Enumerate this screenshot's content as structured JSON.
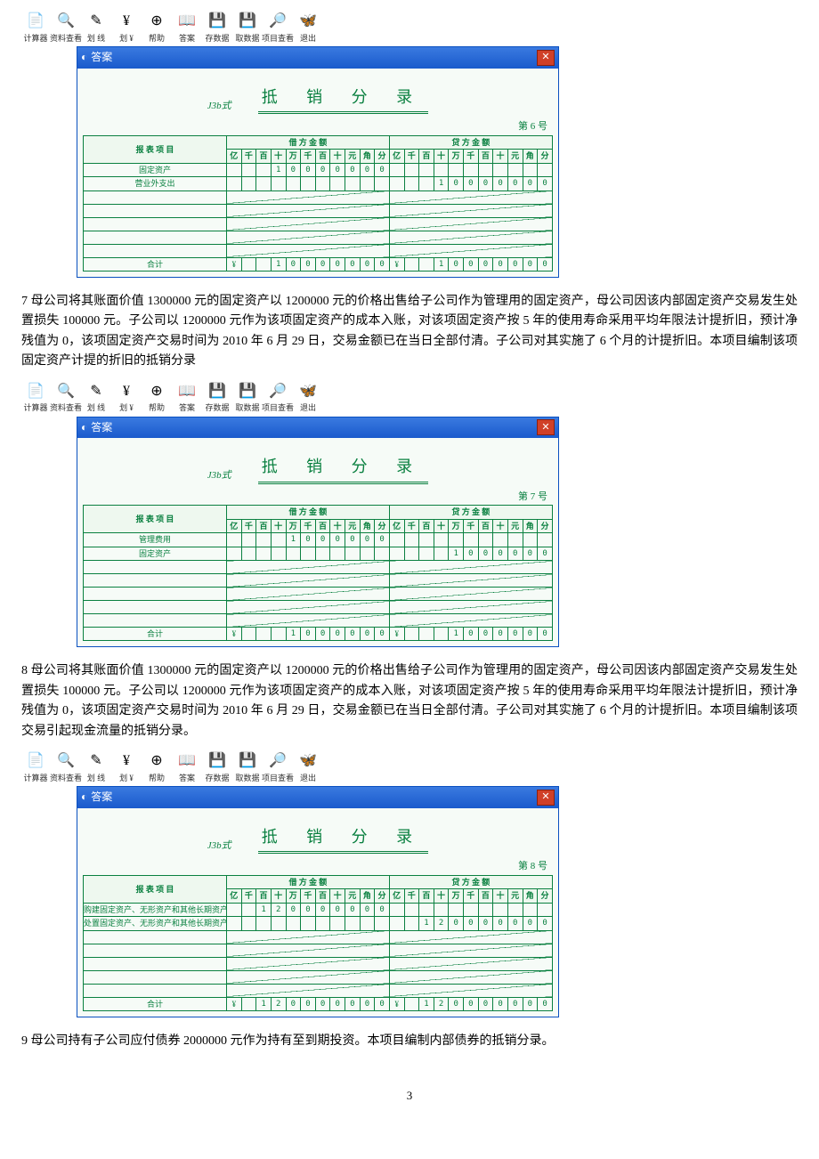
{
  "toolbar": {
    "items": [
      {
        "icon": "📄",
        "label": "计算器"
      },
      {
        "icon": "🔍",
        "label": "资料查看"
      },
      {
        "icon": "✎",
        "label": "划 线"
      },
      {
        "icon": "¥",
        "label": "划 ¥"
      },
      {
        "icon": "⊕",
        "label": "帮助"
      },
      {
        "icon": "📖",
        "label": "答案"
      },
      {
        "icon": "💾",
        "label": "存数据"
      },
      {
        "icon": "💾",
        "label": "取数据"
      },
      {
        "icon": "🔎",
        "label": "项目查看"
      },
      {
        "icon": "🦋",
        "label": "退出"
      }
    ]
  },
  "window": {
    "title": "答案"
  },
  "form": {
    "code": "J3b式",
    "title": "抵 销 分 录",
    "colItem": "报 表 项 目",
    "colDebit": "借 方 金 额",
    "colCredit": "贷 方 金 额",
    "units": [
      "亿",
      "千",
      "百",
      "十",
      "万",
      "千",
      "百",
      "十",
      "元",
      "角",
      "分"
    ],
    "total": "合计",
    "currency": "¥"
  },
  "entries": [
    {
      "num": "第 6 号",
      "rows": [
        {
          "item": "固定资产",
          "debit": [
            "",
            "",
            "",
            "1",
            "0",
            "0",
            "0",
            "0",
            "0",
            "0",
            "0"
          ],
          "credit": [
            "",
            "",
            "",
            "",
            "",
            "",
            "",
            "",
            "",
            "",
            ""
          ]
        },
        {
          "item": "营业外支出",
          "debit": [
            "",
            "",
            "",
            "",
            "",
            "",
            "",
            "",
            "",
            "",
            ""
          ],
          "credit": [
            "",
            "",
            "",
            "1",
            "0",
            "0",
            "0",
            "0",
            "0",
            "0",
            "0"
          ]
        }
      ],
      "totalDebit": [
        "",
        "",
        "",
        "1",
        "0",
        "0",
        "0",
        "0",
        "0",
        "0",
        "0"
      ],
      "totalCredit": [
        "",
        "",
        "",
        "1",
        "0",
        "0",
        "0",
        "0",
        "0",
        "0",
        "0"
      ]
    },
    {
      "num": "第 7 号",
      "rows": [
        {
          "item": "管理费用",
          "debit": [
            "",
            "",
            "",
            "",
            "1",
            "0",
            "0",
            "0",
            "0",
            "0",
            "0"
          ],
          "credit": [
            "",
            "",
            "",
            "",
            "",
            "",
            "",
            "",
            "",
            "",
            ""
          ]
        },
        {
          "item": "固定资产",
          "debit": [
            "",
            "",
            "",
            "",
            "",
            "",
            "",
            "",
            "",
            "",
            ""
          ],
          "credit": [
            "",
            "",
            "",
            "",
            "1",
            "0",
            "0",
            "0",
            "0",
            "0",
            "0"
          ]
        }
      ],
      "totalDebit": [
        "",
        "",
        "",
        "",
        "1",
        "0",
        "0",
        "0",
        "0",
        "0",
        "0"
      ],
      "totalCredit": [
        "",
        "",
        "",
        "",
        "1",
        "0",
        "0",
        "0",
        "0",
        "0",
        "0"
      ]
    },
    {
      "num": "第 8 号",
      "rows": [
        {
          "item": "购建固定资产、无形资产和其他长期资产支付的现金",
          "debit": [
            "",
            "",
            "1",
            "2",
            "0",
            "0",
            "0",
            "0",
            "0",
            "0",
            "0"
          ],
          "credit": [
            "",
            "",
            "",
            "",
            "",
            "",
            "",
            "",
            "",
            "",
            ""
          ]
        },
        {
          "item": "处置固定资产、无形资产和其他长期资产收到的现金净额",
          "debit": [
            "",
            "",
            "",
            "",
            "",
            "",
            "",
            "",
            "",
            "",
            ""
          ],
          "credit": [
            "",
            "",
            "1",
            "2",
            "0",
            "0",
            "0",
            "0",
            "0",
            "0",
            "0"
          ]
        }
      ],
      "totalDebit": [
        "",
        "",
        "1",
        "2",
        "0",
        "0",
        "0",
        "0",
        "0",
        "0",
        "0"
      ],
      "totalCredit": [
        "",
        "",
        "1",
        "2",
        "0",
        "0",
        "0",
        "0",
        "0",
        "0",
        "0"
      ]
    }
  ],
  "texts": {
    "q7": "7 母公司将其账面价值 1300000 元的固定资产以 1200000 元的价格出售给子公司作为管理用的固定资产，母公司因该内部固定资产交易发生处置损失 100000 元。子公司以 1200000 元作为该项固定资产的成本入账，对该项固定资产按 5 年的使用寿命采用平均年限法计提折旧，预计净残值为 0，该项固定资产交易时间为 2010 年 6 月 29 日，交易金额已在当日全部付清。子公司对其实施了 6 个月的计提折旧。本项目编制该项固定资产计提的折旧的抵销分录",
    "q8": "8 母公司将其账面价值 1300000 元的固定资产以 1200000 元的价格出售给子公司作为管理用的固定资产，母公司因该内部固定资产交易发生处置损失 100000 元。子公司以 1200000 元作为该项固定资产的成本入账，对该项固定资产按 5 年的使用寿命采用平均年限法计提折旧，预计净残值为 0，该项固定资产交易时间为 2010 年 6 月 29 日，交易金额已在当日全部付清。子公司对其实施了 6 个月的计提折旧。本项目编制该项交易引起现金流量的抵销分录。",
    "q9": "9 母公司持有子公司应付债券 2000000 元作为持有至到期投资。本项目编制内部债券的抵销分录。",
    "page": "3"
  }
}
